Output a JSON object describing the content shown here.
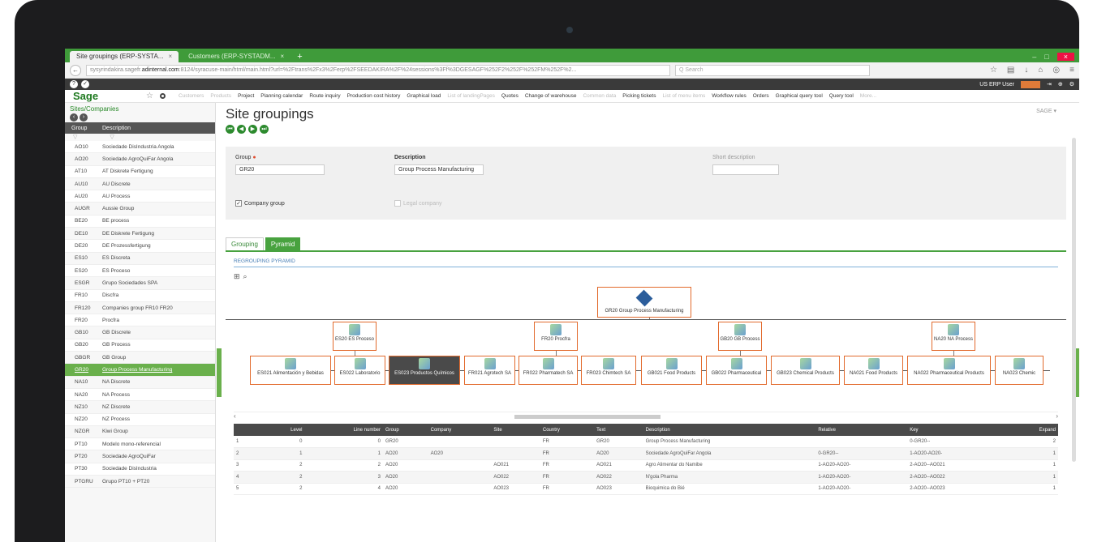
{
  "browser": {
    "tabs": [
      {
        "label": "Site groupings (ERP-SYSTA...",
        "active": true
      },
      {
        "label": "Customers (ERP-SYSTADM...",
        "active": false
      }
    ],
    "new_tab": "+",
    "url_host": "sysyrindakira.sagefr.",
    "url_domain": "adinternal.com",
    "url_path": ":8124/syracuse-main/html/main.html?url=%2Ftrans%2Fx3%2Ferp%2FSEEDAKIRA%2F%24sessions%3Ff%3DGESAGF%252F2%252F%252FM%252F%2...",
    "search_placeholder": "Q Search"
  },
  "sage_bar": {
    "user": "US ERP User"
  },
  "menu": {
    "logo": "Sage",
    "items": [
      {
        "label": "Customers",
        "dim": true
      },
      {
        "label": "Products",
        "dim": true
      },
      {
        "label": "Project",
        "dim": false
      },
      {
        "label": "Planning calendar",
        "dim": false
      },
      {
        "label": "Route inquiry",
        "dim": false
      },
      {
        "label": "Production cost history",
        "dim": false
      },
      {
        "label": "Graphical load",
        "dim": false
      },
      {
        "label": "List of landingPages",
        "dim": true
      },
      {
        "label": "Quotes",
        "dim": false
      },
      {
        "label": "Change of warehouse",
        "dim": false
      },
      {
        "label": "Common data",
        "dim": true
      },
      {
        "label": "Picking tickets",
        "dim": false
      },
      {
        "label": "List of menu items",
        "dim": true
      },
      {
        "label": "Workflow rules",
        "dim": false
      },
      {
        "label": "Orders",
        "dim": false
      },
      {
        "label": "Graphical query tool",
        "dim": false
      },
      {
        "label": "Query tool",
        "dim": false
      },
      {
        "label": "More...",
        "dim": true
      }
    ]
  },
  "sidebar": {
    "title": "Sites/Companies",
    "col_group": "Group",
    "col_description": "Description",
    "rows": [
      {
        "group": "AO10",
        "desc": "Sociedade DisIndustria Angola"
      },
      {
        "group": "AO20",
        "desc": "Sociedade AgroQuiFar Angola"
      },
      {
        "group": "AT10",
        "desc": "AT Diskrete Fertigung"
      },
      {
        "group": "AU10",
        "desc": "AU Discrete"
      },
      {
        "group": "AU20",
        "desc": "AU Process"
      },
      {
        "group": "AUGR",
        "desc": "Aussie Group"
      },
      {
        "group": "BE20",
        "desc": "BE process"
      },
      {
        "group": "DE10",
        "desc": "DE Diskrete Fertigung"
      },
      {
        "group": "DE20",
        "desc": "DE Prozessfertigung"
      },
      {
        "group": "ES10",
        "desc": "ES Discreta"
      },
      {
        "group": "ES20",
        "desc": "ES Proceso"
      },
      {
        "group": "ESGR",
        "desc": "Grupo Sociedades SPA"
      },
      {
        "group": "FR10",
        "desc": "Discfra"
      },
      {
        "group": "FR120",
        "desc": "Companies group FR10 FR20"
      },
      {
        "group": "FR20",
        "desc": "Procfra"
      },
      {
        "group": "GB10",
        "desc": "GB Discrete"
      },
      {
        "group": "GB20",
        "desc": "GB Process"
      },
      {
        "group": "GBGR",
        "desc": "GB Group"
      },
      {
        "group": "GR20",
        "desc": "Group Process Manufacturing",
        "selected": true
      },
      {
        "group": "NA10",
        "desc": "NA Discrete"
      },
      {
        "group": "NA20",
        "desc": "NA Process"
      },
      {
        "group": "NZ10",
        "desc": "NZ Discrete"
      },
      {
        "group": "NZ20",
        "desc": "NZ Process"
      },
      {
        "group": "NZGR",
        "desc": "Kiwi Group"
      },
      {
        "group": "PT10",
        "desc": "Modelo mono-referencial"
      },
      {
        "group": "PT20",
        "desc": "Sociedade AgroQuiFar"
      },
      {
        "group": "PT30",
        "desc": "Sociedade DisIndustria"
      },
      {
        "group": "PTGRU",
        "desc": "Grupo PT10 + PT20"
      }
    ]
  },
  "main": {
    "title": "Site groupings",
    "sage_dropdown": "SAGE",
    "form": {
      "group_label": "Group",
      "group_value": "GR20",
      "description_label": "Description",
      "description_value": "Group Process Manufacturing",
      "short_description_label": "Short description",
      "company_group_label": "Company group",
      "legal_company_label": "Legal company"
    },
    "tabs": [
      "Grouping",
      "Pyramid"
    ],
    "pyramid_title": "REGROUPING PYRAMID"
  },
  "pyramid": {
    "root": "GR20 Group Process Manufacturing",
    "level1": [
      "ES20 ES Proceso",
      "FR20 Procfra",
      "GB20 GB Process",
      "NA20 NA Process"
    ],
    "level2": [
      "ES021 Alimentación y Bebidas",
      "ES022 Laboratorio",
      "ES023 Productos Químicos",
      "FR021 Agrotech SA",
      "FR022 Pharmatech SA",
      "FR023 Chimtech SA",
      "GB021 Food Products",
      "GB022 Pharmaceutical",
      "GB023 Chemical Products",
      "NA021 Food Products",
      "NA022 Pharmaceutical Products",
      "NA023 Chemic"
    ]
  },
  "grid": {
    "headers": [
      "",
      "",
      "Level",
      "Line number",
      "Group",
      "Company",
      "Site",
      "Country",
      "Text",
      "Description",
      "Relative",
      "Key",
      "Expand"
    ],
    "rows": [
      [
        "1",
        "",
        "0",
        "0",
        "GR20",
        "",
        "",
        "FR",
        "GR20",
        "Group Process Manufacturing",
        "",
        "0-GR20--",
        "2"
      ],
      [
        "2",
        "",
        "1",
        "1",
        "AO20",
        "AO20",
        "",
        "FR",
        "AO20",
        "Sociedade AgroQuiFar Angola",
        "0-GR20--",
        "1-AO20-AO20-",
        "1"
      ],
      [
        "3",
        "",
        "2",
        "2",
        "AO20",
        "",
        "AO021",
        "FR",
        "AO021",
        "Agro Alimentar do Namibe",
        "1-AO20-AO20-",
        "2-AO20--AO021",
        "1"
      ],
      [
        "4",
        "",
        "2",
        "3",
        "AO20",
        "",
        "AO022",
        "FR",
        "AO022",
        "N'gola Pharma",
        "1-AO20-AO20-",
        "2-AO20--AO022",
        "1"
      ],
      [
        "5",
        "",
        "2",
        "4",
        "AO20",
        "",
        "AO023",
        "FR",
        "AO023",
        "Bioquimica do Bié",
        "1-AO20-AO20-",
        "2-AO20--AO023",
        "1"
      ]
    ]
  }
}
